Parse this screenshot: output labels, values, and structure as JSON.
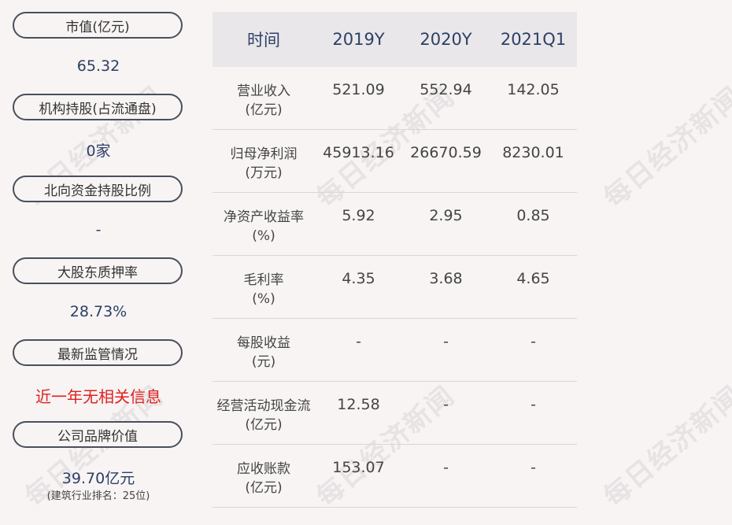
{
  "left_panel": {
    "items": [
      {
        "label": "市值(亿元)",
        "value": "65.32"
      },
      {
        "label": "机构持股(占流通盘)",
        "value": "0家"
      },
      {
        "label": "北向资金持股比例",
        "value": "-"
      },
      {
        "label": "大股东质押率",
        "value": "28.73%"
      },
      {
        "label": "最新监管情况",
        "value": "近一年无相关信息"
      },
      {
        "label": "公司品牌价值",
        "value": "39.70亿元",
        "note": "(建筑行业排名：25位)"
      }
    ]
  },
  "table": {
    "headers": [
      "时间",
      "2019Y",
      "2020Y",
      "2021Q1"
    ],
    "rows": [
      {
        "metric_line1": "营业收入",
        "metric_line2": "(亿元)",
        "values": [
          "521.09",
          "552.94",
          "142.05"
        ]
      },
      {
        "metric_line1": "归母净利润",
        "metric_line2": "(万元)",
        "values": [
          "45913.16",
          "26670.59",
          "8230.01"
        ]
      },
      {
        "metric_line1": "净资产收益率",
        "metric_line2": "(%)",
        "values": [
          "5.92",
          "2.95",
          "0.85"
        ]
      },
      {
        "metric_line1": "毛利率",
        "metric_line2": "(%)",
        "values": [
          "4.35",
          "3.68",
          "4.65"
        ]
      },
      {
        "metric_line1": "每股收益",
        "metric_line2": "(元)",
        "values": [
          "-",
          "-",
          "-"
        ]
      },
      {
        "metric_line1": "经营活动现金流",
        "metric_line2": "(亿元)",
        "values": [
          "12.58",
          "-",
          "-"
        ]
      },
      {
        "metric_line1": "应收账款",
        "metric_line2": "(亿元)",
        "values": [
          "153.07",
          "-",
          "-"
        ]
      }
    ]
  },
  "watermark": "每日经济新闻",
  "colors": {
    "value_blue": "#2d3f66",
    "alert_red": "#e02020",
    "header_bg": "#e9e7ea"
  }
}
